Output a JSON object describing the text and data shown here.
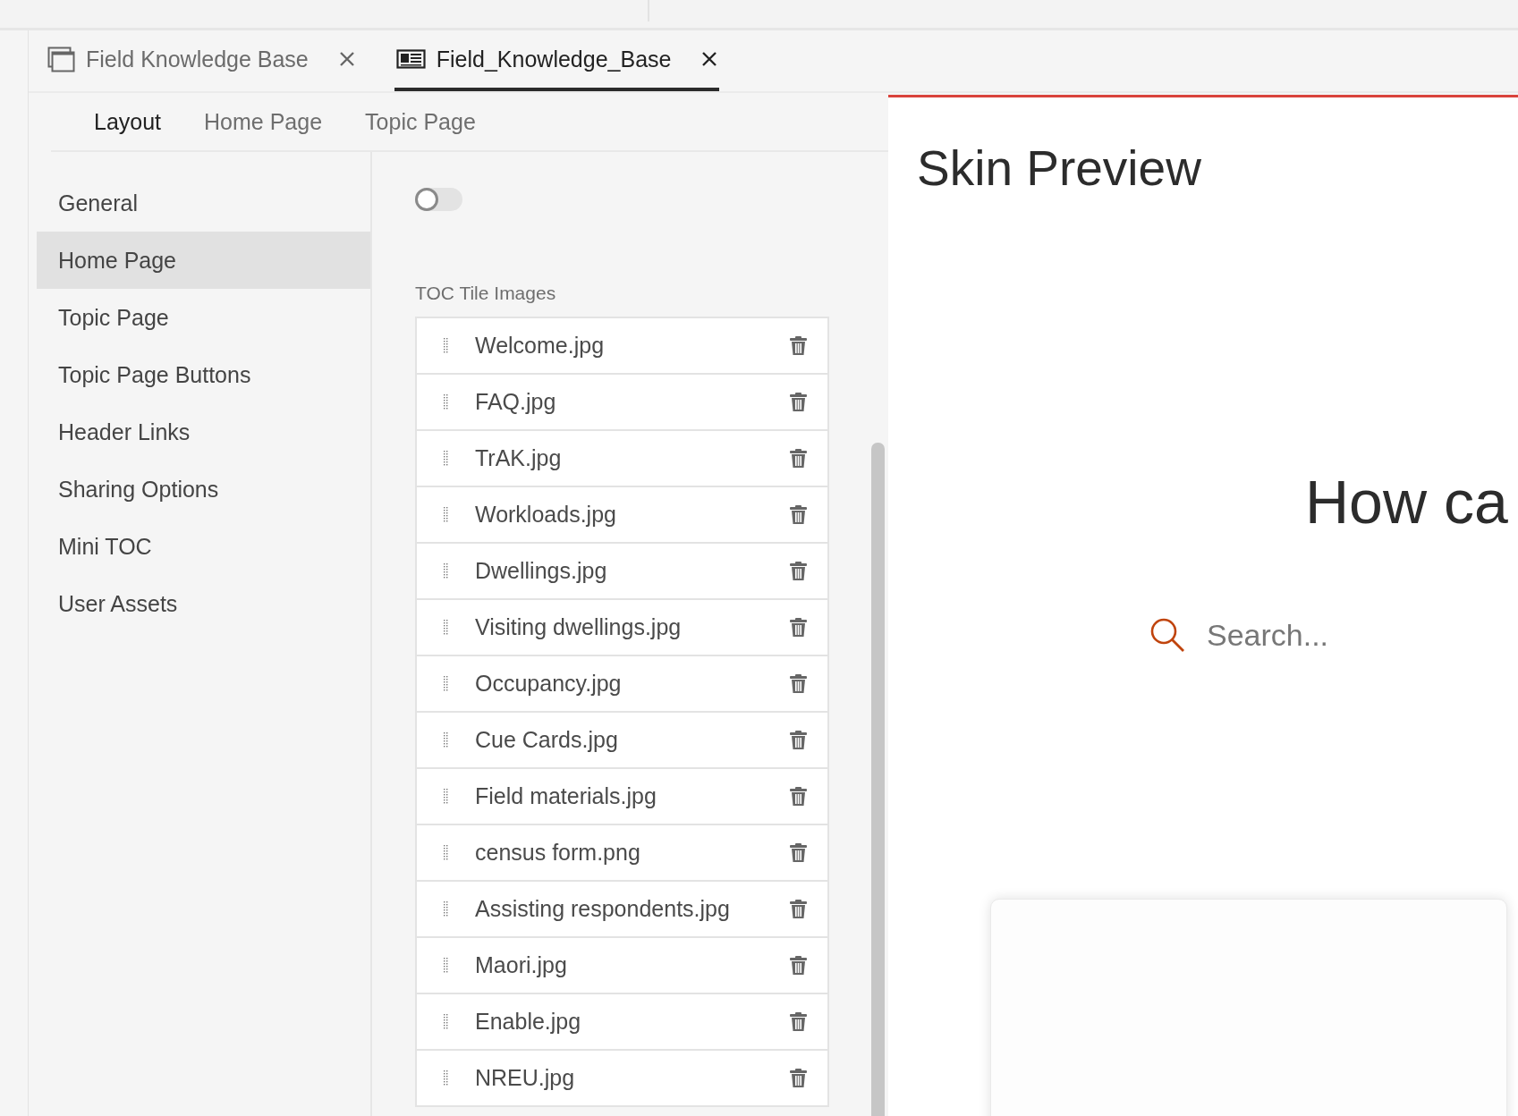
{
  "tabs": [
    {
      "label": "Field Knowledge Base",
      "kind": "window",
      "selected": false
    },
    {
      "label": "Field_Knowledge_Base",
      "kind": "document",
      "selected": true
    }
  ],
  "subtabs": [
    {
      "label": "Layout",
      "selected": true
    },
    {
      "label": "Home Page",
      "selected": false
    },
    {
      "label": "Topic Page",
      "selected": false
    }
  ],
  "sidebar": {
    "items": [
      {
        "label": "General",
        "selected": false
      },
      {
        "label": "Home Page",
        "selected": true
      },
      {
        "label": "Topic Page",
        "selected": false
      },
      {
        "label": "Topic Page Buttons",
        "selected": false
      },
      {
        "label": "Header Links",
        "selected": false
      },
      {
        "label": "Sharing Options",
        "selected": false
      },
      {
        "label": "Mini TOC",
        "selected": false
      },
      {
        "label": "User Assets",
        "selected": false
      }
    ]
  },
  "settings": {
    "toggle": {
      "on": false
    },
    "toc_tile_images": {
      "label": "TOC Tile Images",
      "items": [
        "Welcome.jpg",
        "FAQ.jpg",
        "TrAK.jpg",
        "Workloads.jpg",
        "Dwellings.jpg",
        "Visiting dwellings.jpg",
        "Occupancy.jpg",
        "Cue Cards.jpg",
        "Field materials.jpg",
        "census form.png",
        "Assisting respondents.jpg",
        "Maori.jpg",
        "Enable.jpg",
        "NREU.jpg"
      ]
    }
  },
  "preview": {
    "title": "Skin Preview",
    "heading": "How ca",
    "search": {
      "placeholder": "Search..."
    }
  }
}
